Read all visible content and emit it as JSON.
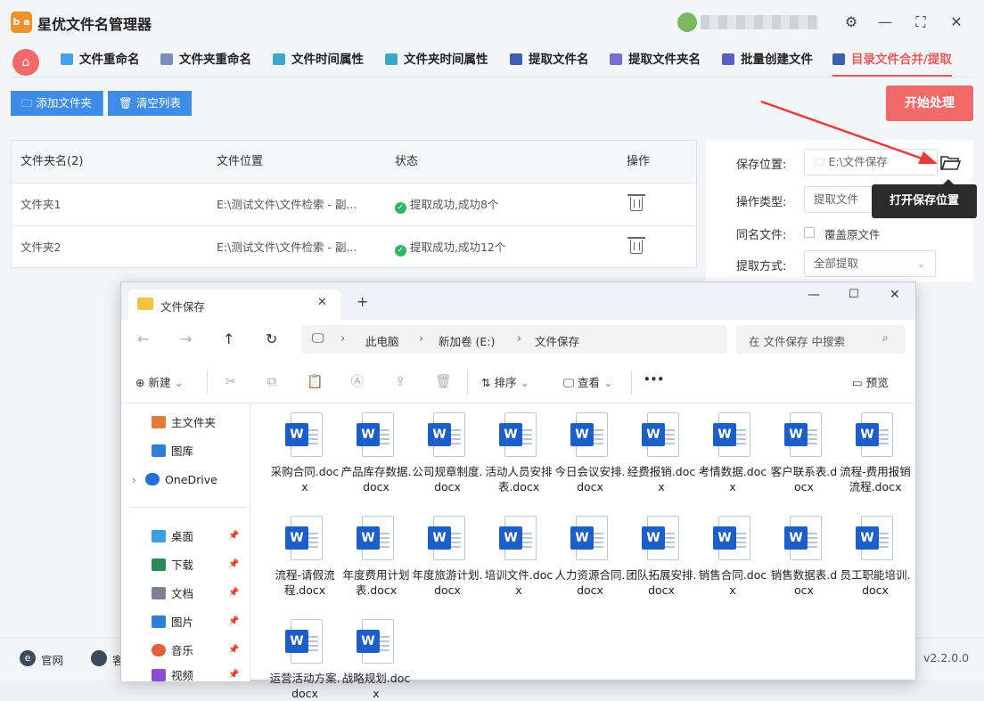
{
  "app": {
    "logo_text": "b a",
    "title": "星优文件名管理器",
    "version": "v2.2.0.0",
    "window_controls": [
      "settings-icon",
      "minimize-icon",
      "maximize-icon",
      "close-icon"
    ]
  },
  "tabs": [
    {
      "label": "文件重命名",
      "icon": "rename-icon",
      "color": "#46a1e8"
    },
    {
      "label": "文件夹重命名",
      "icon": "folder-rename-icon",
      "color": "#7a8fb5"
    },
    {
      "label": "文件时间属性",
      "icon": "file-time-icon",
      "color": "#3fa7c9"
    },
    {
      "label": "文件夹时间属性",
      "icon": "folder-time-icon",
      "color": "#3fa7c9"
    },
    {
      "label": "提取文件名",
      "icon": "extract-name-icon",
      "color": "#3d5fb0"
    },
    {
      "label": "提取文件夹名",
      "icon": "extract-folder-icon",
      "color": "#7a6fd0"
    },
    {
      "label": "批量创建文件",
      "icon": "batch-create-icon",
      "color": "#5a5fc0"
    },
    {
      "label": "目录文件合并/提取",
      "icon": "merge-icon",
      "color": "#3d5fb0",
      "active": true
    }
  ],
  "toolbar": {
    "add_folder": "添加文件夹",
    "clear_list": "清空列表",
    "start": "开始处理"
  },
  "table": {
    "headers": [
      "文件夹名(2)",
      "文件位置",
      "状态",
      "操作"
    ],
    "rows": [
      {
        "name": "文件夹1",
        "path": "E:\\测试文件\\文件检索 - 副...",
        "status": "提取成功,成功8个"
      },
      {
        "name": "文件夹2",
        "path": "E:\\测试文件\\文件检索 - 副...",
        "status": "提取成功,成功12个"
      }
    ]
  },
  "settings": {
    "save_label": "保存位置:",
    "save_value": "E:\\文件保存",
    "op_label": "操作类型:",
    "op_value": "提取文件",
    "same_label": "同名文件:",
    "same_option": "覆盖原文件",
    "mode_label": "提取方式:",
    "mode_value": "全部提取",
    "tooltip": "打开保存位置"
  },
  "footer": {
    "site": "官网",
    "service": "客"
  },
  "explorer": {
    "tab_title": "文件保存",
    "breadcrumb": [
      "此电脑",
      "新加卷 (E:)",
      "文件保存"
    ],
    "search_placeholder": "在 文件保存 中搜索",
    "cmd": {
      "new": "新建",
      "sort": "排序",
      "view": "查看",
      "more": "•••",
      "preview": "预览"
    },
    "nav": [
      {
        "label": "主文件夹",
        "icon": "home-icon",
        "color": "#e07b39"
      },
      {
        "label": "图库",
        "icon": "gallery-icon",
        "color": "#2f7fd6"
      },
      {
        "label": "OneDrive",
        "icon": "cloud-icon",
        "color": "#1f73d8"
      },
      {
        "label": "桌面",
        "icon": "desktop-icon",
        "color": "#3aa0e0"
      },
      {
        "label": "下载",
        "icon": "download-icon",
        "color": "#2a8a5c"
      },
      {
        "label": "文档",
        "icon": "documents-icon",
        "color": "#7a8391"
      },
      {
        "label": "图片",
        "icon": "pictures-icon",
        "color": "#2f7fd6"
      },
      {
        "label": "音乐",
        "icon": "music-icon",
        "color": "#e3603a"
      },
      {
        "label": "视频",
        "icon": "video-icon",
        "color": "#8a4fd0"
      }
    ],
    "files": [
      "采购合同.docx",
      "产品库存数据.docx",
      "公司规章制度.docx",
      "活动人员安排表.docx",
      "今日会议安排.docx",
      "经费报销.docx",
      "考情数据.docx",
      "客户联系表.docx",
      "流程-费用报销流程.docx",
      "流程-请假流程.docx",
      "年度费用计划表.docx",
      "年度旅游计划.docx",
      "培训文件.docx",
      "人力资源合同.docx",
      "团队拓展安排.docx",
      "销售合同.docx",
      "销售数据表.docx",
      "员工职能培训.docx",
      "运营活动方案.docx",
      "战略规划.docx"
    ]
  }
}
